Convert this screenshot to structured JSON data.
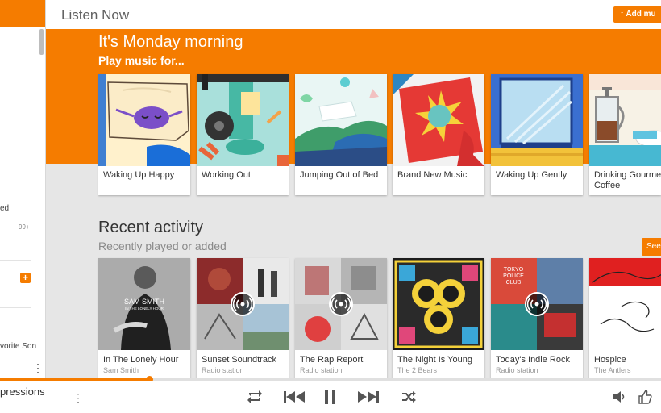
{
  "header": {
    "title": "Listen Now",
    "add_button": "Add mu"
  },
  "sidebar": {
    "partial_labels": [
      "ed",
      "vorite Son"
    ],
    "badge": "99+",
    "plus": "+",
    "more": "⋮"
  },
  "hero": {
    "title": "It's Monday morning",
    "subtitle": "Play music for..."
  },
  "moods": [
    {
      "title": "Waking Up Happy"
    },
    {
      "title": "Working Out"
    },
    {
      "title": "Jumping Out of Bed"
    },
    {
      "title": "Brand New Music"
    },
    {
      "title": "Waking Up Gently"
    },
    {
      "title": "Drinking Gourmet Coffee"
    }
  ],
  "recent": {
    "title": "Recent activity",
    "subtitle": "Recently played or added",
    "see_all": "See",
    "items": [
      {
        "title": "In The Lonely Hour",
        "subtitle": "Sam Smith",
        "art_line1": "SAM SMITH",
        "art_line2": "IN THE LONELY HOUR",
        "radio": false
      },
      {
        "title": "Sunset Soundtrack",
        "subtitle": "Radio station",
        "radio": true
      },
      {
        "title": "The Rap Report",
        "subtitle": "Radio station",
        "radio": true
      },
      {
        "title": "The Night Is Young",
        "subtitle": "The 2 Bears",
        "radio": false
      },
      {
        "title": "Today's Indie Rock",
        "subtitle": "Radio station",
        "art_line1": "TOKYO",
        "art_line2": "POLICE",
        "art_line3": "CLUB",
        "radio": true
      },
      {
        "title": "Hospice",
        "subtitle": "The Antlers",
        "radio": false
      }
    ]
  },
  "player": {
    "now_playing": "pressions",
    "progress": 0.226,
    "more": "⋮"
  },
  "colors": {
    "accent": "#f57c00",
    "background": "#e6e6e6"
  },
  "icons": [
    "repeat-icon",
    "previous-icon",
    "pause-icon",
    "next-icon",
    "shuffle-icon",
    "volume-icon",
    "thumbs-up-icon",
    "radio-icon"
  ]
}
